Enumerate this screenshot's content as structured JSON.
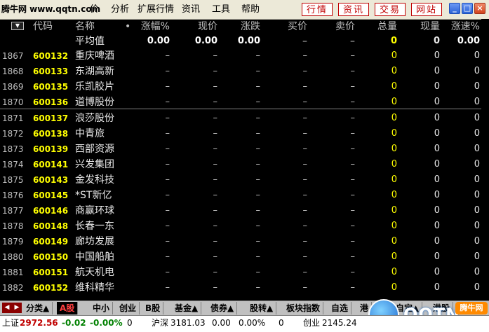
{
  "menubar": {
    "logo": "腾牛网 www.qqtn.com",
    "menu_items": [
      "价",
      "分析",
      "扩展行情",
      "资讯",
      "工具",
      "帮助"
    ],
    "quick_buttons": [
      "行情",
      "资讯",
      "交易",
      "网站"
    ],
    "window_buttons": [
      "_",
      "□",
      "×"
    ]
  },
  "table": {
    "headers": {
      "code": "代码",
      "name": "名称",
      "dot": "•",
      "change_pct": "涨幅%",
      "price": "现价",
      "change": "涨跌",
      "bid": "买价",
      "ask": "卖价",
      "volume": "总量",
      "cur_volume": "现量",
      "speed": "涨速%"
    },
    "average": {
      "label": "平均值",
      "change_pct": "0.00",
      "price": "0.00",
      "change": "0.00",
      "bid": "–",
      "ask": "–",
      "volume": "0",
      "cur_volume": "0",
      "speed": "0.00"
    },
    "rows": [
      {
        "idx": "1867",
        "code": "600132",
        "name": "重庆啤酒"
      },
      {
        "idx": "1868",
        "code": "600133",
        "name": "东湖高新"
      },
      {
        "idx": "1869",
        "code": "600135",
        "name": "乐凯胶片"
      },
      {
        "idx": "1870",
        "code": "600136",
        "name": "道博股份"
      },
      {
        "idx": "1871",
        "code": "600137",
        "name": "浪莎股份"
      },
      {
        "idx": "1872",
        "code": "600138",
        "name": "中青旅"
      },
      {
        "idx": "1873",
        "code": "600139",
        "name": "西部资源"
      },
      {
        "idx": "1874",
        "code": "600141",
        "name": "兴发集团"
      },
      {
        "idx": "1875",
        "code": "600143",
        "name": "金发科技"
      },
      {
        "idx": "1876",
        "code": "600145",
        "name": "*ST新亿"
      },
      {
        "idx": "1877",
        "code": "600146",
        "name": "商赢环球"
      },
      {
        "idx": "1878",
        "code": "600148",
        "name": "长春一东"
      },
      {
        "idx": "1879",
        "code": "600149",
        "name": "廊坊发展"
      },
      {
        "idx": "1880",
        "code": "600150",
        "name": "中国船舶"
      },
      {
        "idx": "1881",
        "code": "600151",
        "name": "航天机电"
      },
      {
        "idx": "1882",
        "code": "600152",
        "name": "维科精华"
      }
    ],
    "row_values": {
      "change_pct": "–",
      "price": "–",
      "change": "–",
      "bid": "–",
      "ask": "–",
      "volume": "0",
      "cur_volume": "0",
      "speed": "0"
    }
  },
  "tabs": {
    "arrows": [
      "◀",
      "▶"
    ],
    "items": [
      "分类▲",
      "A股",
      "中小",
      "创业",
      "B股",
      "基金▲",
      "债券▲",
      "股转▲",
      "板块指数",
      "自选",
      "港",
      "自定▲",
      "港股"
    ],
    "active_index": 1
  },
  "watermark": {
    "text": "QQTN",
    "badge": "腾牛网"
  },
  "statusbar": {
    "sh_label": "上证",
    "sh_value": "2972.56",
    "sh_change": "-0.02",
    "sh_pct": "-0.00%",
    "sh_vol": "0",
    "hs_label": "沪深",
    "hs_value": "3181.03",
    "hs_change": "0.00",
    "hs_pct": "0.00%",
    "hs_vol": "0",
    "cy_label": "创业",
    "cy_value": "2145.24"
  }
}
